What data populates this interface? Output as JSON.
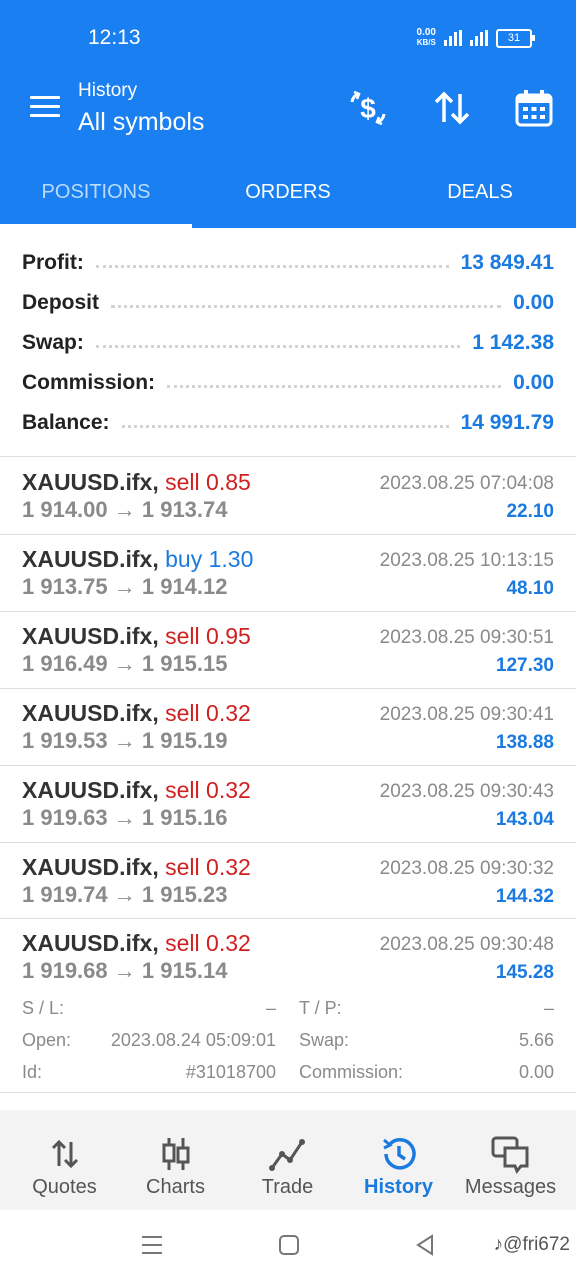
{
  "status": {
    "time": "12:13",
    "net_speed": "0.00",
    "net_unit": "KB/S",
    "battery": "31"
  },
  "header": {
    "subtitle": "History",
    "title": "All symbols"
  },
  "tabs": [
    "POSITIONS",
    "ORDERS",
    "DEALS"
  ],
  "summary": [
    {
      "label": "Profit:",
      "value": "13 849.41"
    },
    {
      "label": "Deposit",
      "value": "0.00"
    },
    {
      "label": "Swap:",
      "value": "1 142.38"
    },
    {
      "label": "Commission:",
      "value": "0.00"
    },
    {
      "label": "Balance:",
      "value": "14 991.79"
    }
  ],
  "positions": [
    {
      "symbol": "XAUUSD.ifx,",
      "side": "sell 0.85",
      "prices": "1 914.00 → 1 913.74",
      "datetime": "2023.08.25 07:04:08",
      "profit": "22.10"
    },
    {
      "symbol": "XAUUSD.ifx,",
      "side": "buy 1.30",
      "prices": "1 913.75 → 1 914.12",
      "datetime": "2023.08.25 10:13:15",
      "profit": "48.10"
    },
    {
      "symbol": "XAUUSD.ifx,",
      "side": "sell 0.95",
      "prices": "1 916.49 → 1 915.15",
      "datetime": "2023.08.25 09:30:51",
      "profit": "127.30"
    },
    {
      "symbol": "XAUUSD.ifx,",
      "side": "sell 0.32",
      "prices": "1 919.53 → 1 915.19",
      "datetime": "2023.08.25 09:30:41",
      "profit": "138.88"
    },
    {
      "symbol": "XAUUSD.ifx,",
      "side": "sell 0.32",
      "prices": "1 919.63 → 1 915.16",
      "datetime": "2023.08.25 09:30:43",
      "profit": "143.04"
    },
    {
      "symbol": "XAUUSD.ifx,",
      "side": "sell 0.32",
      "prices": "1 919.74 → 1 915.23",
      "datetime": "2023.08.25 09:30:32",
      "profit": "144.32"
    },
    {
      "symbol": "XAUUSD.ifx,",
      "side": "sell 0.32",
      "prices": "1 919.68 → 1 915.14",
      "datetime": "2023.08.25 09:30:48",
      "profit": "145.28"
    }
  ],
  "details": {
    "sl_label": "S / L:",
    "sl_value": "–",
    "tp_label": "T / P:",
    "tp_value": "–",
    "open_label": "Open:",
    "open_value": "2023.08.24 05:09:01",
    "swap_label": "Swap:",
    "swap_value": "5.66",
    "id_label": "Id:",
    "id_value": "#31018700",
    "comm_label": "Commission:",
    "comm_value": "0.00"
  },
  "bottom_nav": [
    "Quotes",
    "Charts",
    "Trade",
    "History",
    "Messages"
  ],
  "watermark": "♪@fri672",
  "colors": {
    "primary": "#1a7ff0",
    "sell": "#d02020",
    "buy": "#1a7ae0",
    "value": "#1a7ae0"
  }
}
